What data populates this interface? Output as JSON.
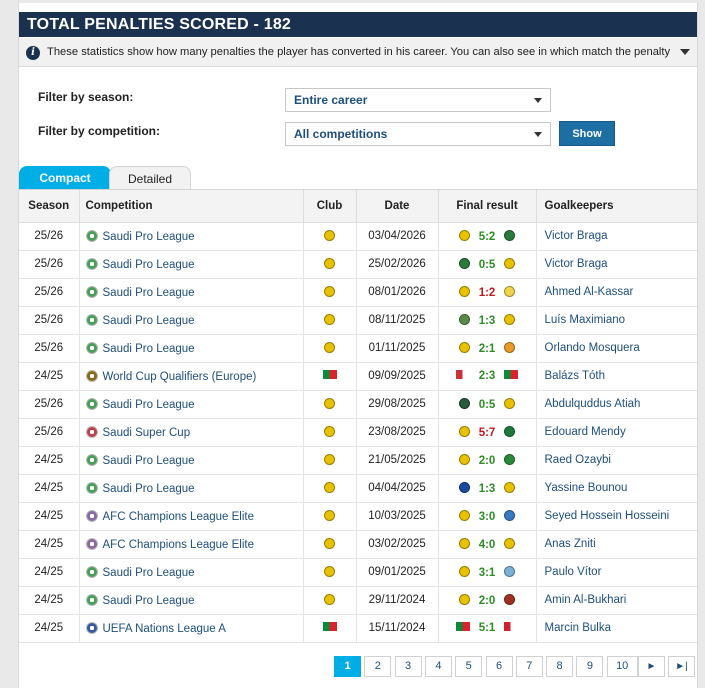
{
  "header": {
    "title": "TOTAL PENALTIES SCORED - 182"
  },
  "info": {
    "text": "These statistics show how many penalties the player has converted in his career. You can also see in which match the penalty was awarded, w..."
  },
  "filters": {
    "season_label": "Filter by season:",
    "season_value": "Entire career",
    "competition_label": "Filter by competition:",
    "competition_value": "All competitions",
    "show_label": "Show"
  },
  "tabs": {
    "compact": "Compact",
    "detailed": "Detailed"
  },
  "columns": [
    "Season",
    "Competition",
    "Club",
    "Date",
    "Final result",
    "Goalkeepers"
  ],
  "rows": [
    {
      "season": "25/26",
      "competition": "Saudi Pro League",
      "comp_color": "#4a9d5b",
      "club_color": "#e8c200",
      "date": "03/04/2026",
      "home_color": "#e8c200",
      "score": "5:2",
      "result": "win",
      "away_color": "#2a7a3a",
      "goalkeeper": "Victor Braga"
    },
    {
      "season": "25/26",
      "competition": "Saudi Pro League",
      "comp_color": "#4a9d5b",
      "club_color": "#e8c200",
      "date": "25/02/2026",
      "home_color": "#2a7a3a",
      "score": "0:5",
      "result": "win",
      "away_color": "#e8c200",
      "goalkeeper": "Victor Braga"
    },
    {
      "season": "25/26",
      "competition": "Saudi Pro League",
      "comp_color": "#4a9d5b",
      "club_color": "#e8c200",
      "date": "08/01/2026",
      "home_color": "#e8c200",
      "score": "1:2",
      "result": "loss",
      "away_color": "#f2d24a",
      "goalkeeper": "Ahmed Al-Kassar"
    },
    {
      "season": "25/26",
      "competition": "Saudi Pro League",
      "comp_color": "#4a9d5b",
      "club_color": "#e8c200",
      "date": "08/11/2025",
      "home_color": "#5a8a4a",
      "score": "1:3",
      "result": "win",
      "away_color": "#e8c200",
      "goalkeeper": "Luís Maximiano"
    },
    {
      "season": "25/26",
      "competition": "Saudi Pro League",
      "comp_color": "#4a9d5b",
      "club_color": "#e8c200",
      "date": "01/11/2025",
      "home_color": "#e8c200",
      "score": "2:1",
      "result": "win",
      "away_color": "#e89a2a",
      "goalkeeper": "Orlando Mosquera"
    },
    {
      "season": "24/25",
      "competition": "World Cup Qualifiers (Europe)",
      "comp_color": "#8a6a1a",
      "club_color": "#0a8a3a",
      "date": "09/09/2025",
      "home_color": "#c8303a",
      "score": "2:3",
      "result": "win",
      "away_color": "#0a8a3a",
      "goalkeeper": "Balázs Tóth"
    },
    {
      "season": "25/26",
      "competition": "Saudi Pro League",
      "comp_color": "#4a9d5b",
      "club_color": "#e8c200",
      "date": "29/08/2025",
      "home_color": "#2a5a3a",
      "score": "0:5",
      "result": "win",
      "away_color": "#e8c200",
      "goalkeeper": "Abdulquddus Atiah"
    },
    {
      "season": "25/26",
      "competition": "Saudi Super Cup",
      "comp_color": "#c04050",
      "club_color": "#e8c200",
      "date": "23/08/2025",
      "home_color": "#e8c200",
      "score": "5:7",
      "result": "loss",
      "away_color": "#1a7a3a",
      "goalkeeper": "Edouard Mendy"
    },
    {
      "season": "24/25",
      "competition": "Saudi Pro League",
      "comp_color": "#4a9d5b",
      "club_color": "#e8c200",
      "date": "21/05/2025",
      "home_color": "#e8c200",
      "score": "2:0",
      "result": "win",
      "away_color": "#2a8a3a",
      "goalkeeper": "Raed Ozaybi"
    },
    {
      "season": "24/25",
      "competition": "Saudi Pro League",
      "comp_color": "#4a9d5b",
      "club_color": "#e8c200",
      "date": "04/04/2025",
      "home_color": "#1a4aa0",
      "score": "1:3",
      "result": "win",
      "away_color": "#e8c200",
      "goalkeeper": "Yassine Bounou"
    },
    {
      "season": "24/25",
      "competition": "AFC Champions League Elite",
      "comp_color": "#8a6aa0",
      "club_color": "#e8c200",
      "date": "10/03/2025",
      "home_color": "#e8c200",
      "score": "3:0",
      "result": "win",
      "away_color": "#3a7ac0",
      "goalkeeper": "Seyed Hossein Hosseini"
    },
    {
      "season": "24/25",
      "competition": "AFC Champions League Elite",
      "comp_color": "#8a6aa0",
      "club_color": "#e8c200",
      "date": "03/02/2025",
      "home_color": "#e8c200",
      "score": "4:0",
      "result": "win",
      "away_color": "#e8c200",
      "goalkeeper": "Anas Zniti"
    },
    {
      "season": "24/25",
      "competition": "Saudi Pro League",
      "comp_color": "#4a9d5b",
      "club_color": "#e8c200",
      "date": "09/01/2025",
      "home_color": "#e8c200",
      "score": "3:1",
      "result": "win",
      "away_color": "#7ab0d8",
      "goalkeeper": "Paulo Vítor"
    },
    {
      "season": "24/25",
      "competition": "Saudi Pro League",
      "comp_color": "#4a9d5b",
      "club_color": "#e8c200",
      "date": "29/11/2024",
      "home_color": "#e8c200",
      "score": "2:0",
      "result": "win",
      "away_color": "#a03020",
      "goalkeeper": "Amin Al-Bukhari"
    },
    {
      "season": "24/25",
      "competition": "UEFA Nations League A",
      "comp_color": "#3a5aa0",
      "club_color": "#0a8a3a",
      "date": "15/11/2024",
      "home_color": "#0a8a3a",
      "score": "5:1",
      "result": "win",
      "away_color": "#d02030",
      "goalkeeper": "Marcin Bulka"
    }
  ],
  "pagination": {
    "pages": [
      "1",
      "2",
      "3",
      "4",
      "5",
      "6",
      "7",
      "8",
      "9",
      "10"
    ],
    "active": "1",
    "next_icon": "►",
    "last_icon": "►|"
  }
}
